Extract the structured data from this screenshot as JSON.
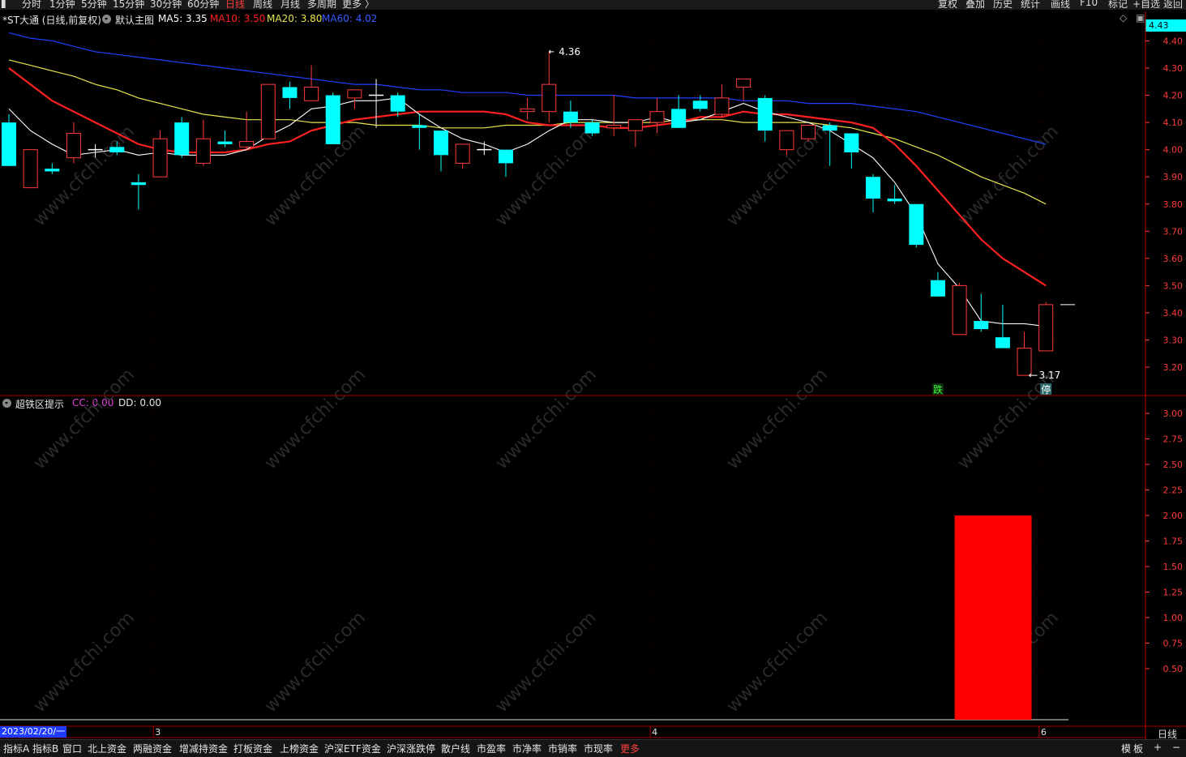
{
  "toolbar": {
    "periods": [
      "分时",
      "1分钟",
      "5分钟",
      "15分钟",
      "30分钟",
      "60分钟",
      "日线",
      "周线",
      "月线",
      "多周期",
      "更多 〉"
    ],
    "active_period": "日线",
    "right_items": [
      "复权",
      "叠加",
      "历史",
      "统计",
      "画线",
      "F10",
      "标记",
      "+自选",
      "返回"
    ]
  },
  "chart_header": {
    "stock": "*ST大通 (日线,前复权)",
    "template": "默认主图",
    "ma5": "MA5: 3.35",
    "ma10": "MA10: 3.50",
    "ma20": "MA20: 3.80",
    "ma60": "MA60: 4.02",
    "current_price": "4.43"
  },
  "colors": {
    "up": "#ff3b3b",
    "down": "#00ffff",
    "ma5": "#ffffff",
    "ma10": "#ff2020",
    "ma20": "#e6e650",
    "ma60": "#2040ff",
    "grid": "#3a0000",
    "axis": "#ff3b3b"
  },
  "chart_data": [
    {
      "type": "candlestick",
      "y_ticks": [
        "4.40",
        "4.30",
        "4.20",
        "4.10",
        "4.00",
        "3.90",
        "3.80",
        "3.70",
        "3.60",
        "3.50",
        "3.40",
        "3.30",
        "3.20"
      ],
      "y_range": [
        3.14,
        4.46
      ],
      "candles": [
        [
          4.1,
          4.13,
          3.96,
          3.94
        ],
        [
          3.86,
          4.0,
          3.86,
          4.0
        ],
        [
          3.93,
          3.95,
          3.91,
          3.92
        ],
        [
          3.97,
          4.1,
          3.95,
          4.06
        ],
        [
          4.0,
          4.02,
          3.97,
          4.0
        ],
        [
          4.01,
          4.03,
          3.98,
          3.99
        ],
        [
          3.88,
          3.91,
          3.78,
          3.87
        ],
        [
          3.9,
          4.07,
          3.9,
          4.04
        ],
        [
          4.1,
          4.12,
          3.97,
          3.98
        ],
        [
          3.95,
          4.11,
          3.94,
          4.04
        ],
        [
          4.03,
          4.07,
          4.01,
          4.02
        ],
        [
          4.01,
          4.14,
          4.0,
          4.03
        ],
        [
          4.04,
          4.24,
          4.04,
          4.24
        ],
        [
          4.23,
          4.25,
          4.15,
          4.19
        ],
        [
          4.18,
          4.31,
          4.18,
          4.23
        ],
        [
          4.2,
          4.21,
          4.02,
          4.02
        ],
        [
          4.19,
          4.22,
          4.15,
          4.22
        ],
        [
          4.2,
          4.26,
          4.08,
          4.2
        ],
        [
          4.2,
          4.21,
          4.12,
          4.14
        ],
        [
          4.09,
          4.13,
          4.0,
          4.08
        ],
        [
          4.07,
          4.07,
          3.92,
          3.98
        ],
        [
          3.95,
          4.02,
          3.93,
          4.02
        ],
        [
          4.0,
          4.03,
          3.98,
          4.0
        ],
        [
          4.0,
          4.0,
          3.9,
          3.95
        ],
        [
          4.14,
          4.19,
          4.11,
          4.15
        ],
        [
          4.14,
          4.36,
          4.1,
          4.24
        ],
        [
          4.14,
          4.18,
          4.08,
          4.1
        ],
        [
          4.1,
          4.11,
          4.05,
          4.06
        ],
        [
          4.08,
          4.2,
          4.05,
          4.09
        ],
        [
          4.07,
          4.11,
          4.01,
          4.11
        ],
        [
          4.1,
          4.19,
          4.06,
          4.14
        ],
        [
          4.15,
          4.2,
          4.08,
          4.08
        ],
        [
          4.18,
          4.2,
          4.14,
          4.15
        ],
        [
          4.13,
          4.24,
          4.12,
          4.19
        ],
        [
          4.23,
          4.26,
          4.18,
          4.26
        ],
        [
          4.19,
          4.2,
          4.03,
          4.07
        ],
        [
          4.0,
          4.07,
          3.98,
          4.07
        ],
        [
          4.04,
          4.09,
          4.03,
          4.09
        ],
        [
          4.09,
          4.1,
          3.94,
          4.07
        ],
        [
          4.06,
          4.06,
          3.93,
          3.99
        ],
        [
          3.9,
          3.91,
          3.77,
          3.82
        ],
        [
          3.82,
          3.87,
          3.8,
          3.81
        ],
        [
          3.8,
          3.8,
          3.64,
          3.65
        ],
        [
          3.52,
          3.55,
          3.46,
          3.46
        ],
        [
          3.32,
          3.51,
          3.32,
          3.5
        ],
        [
          3.37,
          3.47,
          3.33,
          3.34
        ],
        [
          3.31,
          3.43,
          3.27,
          3.27
        ],
        [
          3.17,
          3.33,
          3.17,
          3.27
        ],
        [
          3.26,
          3.44,
          3.26,
          3.43
        ]
      ],
      "ma5": [
        4.15,
        4.07,
        4.02,
        3.98,
        3.99,
        4.0,
        3.98,
        3.99,
        3.98,
        3.98,
        3.98,
        4.0,
        4.05,
        4.09,
        4.15,
        4.16,
        4.18,
        4.18,
        4.19,
        4.13,
        4.08,
        4.04,
        4.02,
        3.99,
        4.02,
        4.07,
        4.11,
        4.11,
        4.1,
        4.1,
        4.12,
        4.1,
        4.11,
        4.14,
        4.17,
        4.14,
        4.12,
        4.1,
        4.07,
        4.02,
        3.97,
        3.88,
        3.76,
        3.58,
        3.49,
        3.37,
        3.36,
        3.36,
        3.35
      ],
      "ma10": [
        4.3,
        4.24,
        4.18,
        4.14,
        4.1,
        4.06,
        4.02,
        4.0,
        3.99,
        3.99,
        3.99,
        4.0,
        4.02,
        4.03,
        4.07,
        4.09,
        4.11,
        4.12,
        4.13,
        4.14,
        4.14,
        4.14,
        4.14,
        4.13,
        4.1,
        4.09,
        4.09,
        4.09,
        4.08,
        4.08,
        4.09,
        4.1,
        4.12,
        4.12,
        4.14,
        4.13,
        4.13,
        4.12,
        4.11,
        4.1,
        4.08,
        4.02,
        3.94,
        3.85,
        3.76,
        3.67,
        3.6,
        3.55,
        3.5
      ],
      "ma20": [
        4.33,
        4.31,
        4.29,
        4.27,
        4.24,
        4.22,
        4.19,
        4.17,
        4.15,
        4.13,
        4.12,
        4.11,
        4.11,
        4.11,
        4.1,
        4.1,
        4.1,
        4.09,
        4.09,
        4.09,
        4.08,
        4.08,
        4.08,
        4.09,
        4.09,
        4.09,
        4.1,
        4.1,
        4.1,
        4.1,
        4.1,
        4.11,
        4.11,
        4.11,
        4.1,
        4.1,
        4.1,
        4.1,
        4.09,
        4.08,
        4.06,
        4.04,
        4.01,
        3.98,
        3.94,
        3.9,
        3.87,
        3.84,
        3.8
      ],
      "ma60": [
        4.43,
        4.41,
        4.4,
        4.38,
        4.36,
        4.35,
        4.34,
        4.33,
        4.32,
        4.31,
        4.3,
        4.29,
        4.28,
        4.27,
        4.26,
        4.25,
        4.24,
        4.24,
        4.23,
        4.22,
        4.22,
        4.21,
        4.21,
        4.21,
        4.2,
        4.2,
        4.2,
        4.2,
        4.2,
        4.19,
        4.19,
        4.19,
        4.19,
        4.19,
        4.18,
        4.18,
        4.18,
        4.17,
        4.17,
        4.17,
        4.16,
        4.15,
        4.14,
        4.12,
        4.1,
        4.08,
        4.06,
        4.04,
        4.02
      ],
      "annotations": {
        "high": "4.36",
        "low": "3.17",
        "high_index": 25,
        "low_index": 47
      },
      "markers": [
        {
          "index": 43,
          "text": "跌"
        },
        {
          "index": 48,
          "text": "停"
        }
      ],
      "last_price": 3.43
    },
    {
      "type": "bar",
      "title": "超铁区提示",
      "cc": "CC: 0.00",
      "dd": "DD: 0.00",
      "y_ticks": [
        "3.00",
        "2.75",
        "2.50",
        "2.25",
        "2.00",
        "1.75",
        "1.50",
        "1.25",
        "1.00",
        "0.75",
        "0.50"
      ],
      "y_range": [
        0,
        3.0
      ],
      "bars": [
        {
          "start_index": 44,
          "end_index": 47,
          "value": 2.0
        }
      ]
    }
  ],
  "x_axis": {
    "date": "2023/02/20/一",
    "month_labels": [
      {
        "index": 7,
        "text": "3"
      },
      {
        "index": 30,
        "text": "4"
      },
      {
        "index": 48,
        "text": "6"
      }
    ],
    "period": "日线"
  },
  "bottom_tabs": [
    "指标A",
    "指标B",
    "窗口",
    "北上资金",
    "两融资金",
    "增减持资金",
    "打板资金",
    "上榜资金",
    "沪深ETF资金",
    "沪深涨跌停",
    "散户线",
    "市盈率",
    "市净率",
    "市销率",
    "市现率",
    "更多"
  ],
  "bottom_right": [
    "模",
    "板",
    "+",
    "−"
  ],
  "watermark": "www.cfchi.com"
}
